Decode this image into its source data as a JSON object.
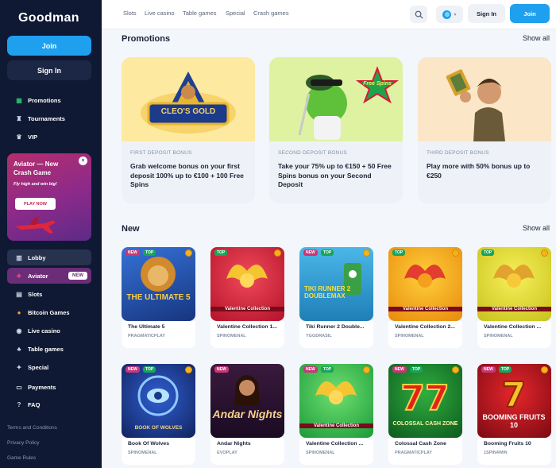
{
  "brand": {
    "name": "Goodman"
  },
  "sidebar": {
    "join_label": "Join",
    "signin_label": "Sign In",
    "top_items": [
      {
        "label": "Promotions",
        "icon": "gift-icon"
      },
      {
        "label": "Tournaments",
        "icon": "trophy-icon"
      },
      {
        "label": "VIP",
        "icon": "crown-icon"
      }
    ],
    "promo": {
      "title": "Aviator — New Crash Game",
      "subtitle": "Fly high and win big!",
      "button": "PLAY NOW"
    },
    "items": [
      {
        "label": "Lobby",
        "icon": "lobby-icon"
      },
      {
        "label": "Aviator",
        "icon": "aviator-icon",
        "badge": "NEW"
      },
      {
        "label": "Slots",
        "icon": "slots-icon"
      },
      {
        "label": "Bitcoin Games",
        "icon": "bitcoin-icon"
      },
      {
        "label": "Live casino",
        "icon": "live-casino-icon"
      },
      {
        "label": "Table games",
        "icon": "table-games-icon"
      },
      {
        "label": "Special",
        "icon": "special-icon"
      },
      {
        "label": "Payments",
        "icon": "payments-icon"
      },
      {
        "label": "FAQ",
        "icon": "faq-icon"
      }
    ],
    "footer": [
      "Terms and Conditions",
      "Privacy Policy",
      "Game Rules"
    ]
  },
  "topbar": {
    "nav": [
      "Slots",
      "Live casino",
      "Table games",
      "Special",
      "Crash games"
    ],
    "signin": "Sign In",
    "join": "Join"
  },
  "promotions": {
    "title": "Promotions",
    "show_all": "Show all",
    "cards": [
      {
        "tag": "FIRST DEPOSIT BONUS",
        "text": "Grab welcome bonus on your first deposit 100% up to €100 + 100 Free Spins",
        "art": "CLEO'S GOLD"
      },
      {
        "tag": "SECOND DEPOSIT BONUS",
        "text": "Take your 75% up to €150 + 50 Free Spins bonus on your Second Deposit",
        "art": "Free Spins"
      },
      {
        "tag": "THIRD DEPOSIT BONUS",
        "text": "Play more with 50% bonus up to €250",
        "art": ""
      }
    ]
  },
  "new_games": {
    "title": "New",
    "show_all": "Show all",
    "row1": [
      {
        "name": "The Ultimate 5",
        "provider": "PRAGMATICPLAY",
        "badges": [
          "NEW",
          "TOP"
        ],
        "art": "THE ULTIMATE 5"
      },
      {
        "name": "Valentine Collection 1...",
        "provider": "SPINOMENAL",
        "badges": [
          "TOP"
        ],
        "art": "Valentine Collection"
      },
      {
        "name": "Tiki Runner 2 Double...",
        "provider": "YGGDRASIL",
        "badges": [
          "NEW",
          "TOP"
        ],
        "art": "TIKI RUNNER 2 DOUBLEMAX"
      },
      {
        "name": "Valentine Collection 2...",
        "provider": "SPINOMENAL",
        "badges": [
          "TOP"
        ],
        "art": "Valentine Collection"
      },
      {
        "name": "Valentine Collection ...",
        "provider": "SPINOMENAL",
        "badges": [
          "TOP"
        ],
        "art": "Valentine Collection"
      }
    ],
    "row2": [
      {
        "name": "Book Of Wolves",
        "provider": "SPINOMENAL",
        "badges": [
          "NEW",
          "TOP"
        ],
        "art": "BOOK OF WOLVES"
      },
      {
        "name": "Andar Nights",
        "provider": "EVOPLAY",
        "badges": [
          "NEW"
        ],
        "art": "Andar Nights"
      },
      {
        "name": "Valentine Collection ...",
        "provider": "SPINOMENAL",
        "badges": [
          "NEW",
          "TOP"
        ],
        "art": "Valentine Collection"
      },
      {
        "name": "Colossal Cash Zone",
        "provider": "PRAGMATICPLAY",
        "badges": [
          "NEW",
          "TOP"
        ],
        "art": "COLOSSAL CASH ZONE"
      },
      {
        "name": "Booming Fruits 10",
        "provider": "1SPIN4WIN",
        "badges": [
          "NEW",
          "TOP"
        ],
        "art": "BOOMING FRUITS 10"
      }
    ]
  },
  "colors": {
    "accent": "#1fa0ef",
    "sidebar": "#0f1933",
    "aviator": "#6b2d77",
    "new_badge": "#c73778",
    "top_badge": "#19a45b"
  }
}
